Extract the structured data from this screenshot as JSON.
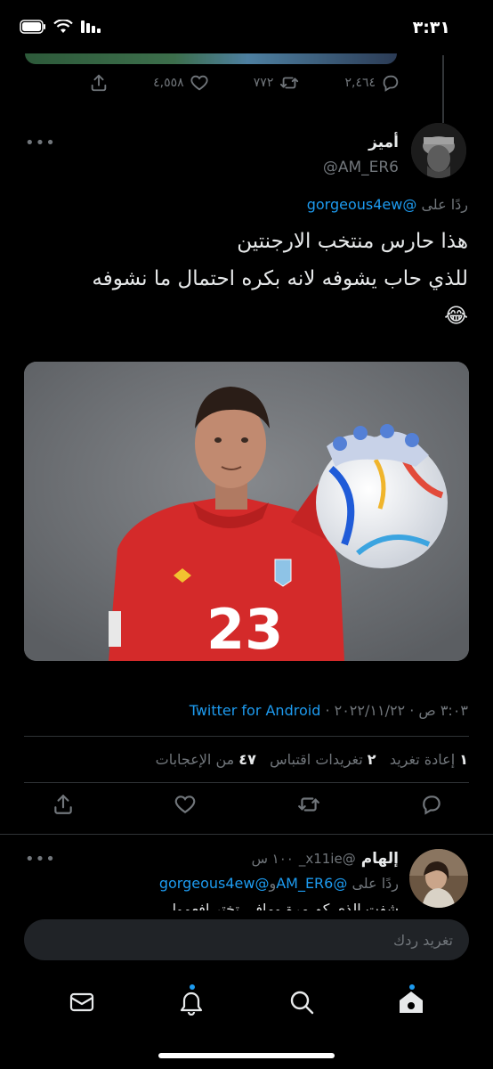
{
  "status_bar": {
    "time": "٣:٣١"
  },
  "prev_tweet_actions": {
    "replies": "٢,٤٦٤",
    "retweets": "٧٧٢",
    "likes": "٤,٥٥٨"
  },
  "tweet": {
    "author_name": "أميز",
    "author_handle": "@AM_ER6",
    "reply_prefix": "ردًا على",
    "reply_to": "@gorgeous4ew",
    "text_line1": "هذا حارس منتخب الارجنتين",
    "text_line2": "للذي حاب يشوفه لانه بكره احتمال ما نشوفه",
    "text_emoji": "😂",
    "photo_jersey_number": "23",
    "timestamp": "٣:٠٣ ص · ٢٠٢٢/١١/٢٢ ·",
    "source": "Twitter for Android",
    "stats": {
      "retweets_count": "١",
      "retweets_label": "إعادة تغريد",
      "quotes_count": "٢",
      "quotes_label": "تغريدات اقتباس",
      "likes_count": "٤٧",
      "likes_label": "من الإعجابات"
    }
  },
  "reply": {
    "author_name": "إلهام",
    "author_handle": "@x11ie_",
    "time_ago": "١٠٠ س",
    "reply_prefix": "ردًا على",
    "reply_to_1": "@AM_ER6",
    "conjunction": "و",
    "reply_to_2": "@gorgeous4ew",
    "text_partial": "شفت الذي كم مرة ومافي تختر افعموا"
  },
  "composer": {
    "placeholder": "تغريد ردك"
  },
  "tabbar": {
    "items": [
      {
        "name": "messages",
        "icon": "mail-icon"
      },
      {
        "name": "notifications",
        "icon": "bell-icon",
        "badge": true
      },
      {
        "name": "search",
        "icon": "search-icon"
      },
      {
        "name": "home",
        "icon": "home-icon",
        "badge": true
      }
    ]
  },
  "colors": {
    "accent": "#1d9bf0",
    "muted": "#71767b",
    "text": "#e7e9ea",
    "bg": "#000000"
  }
}
